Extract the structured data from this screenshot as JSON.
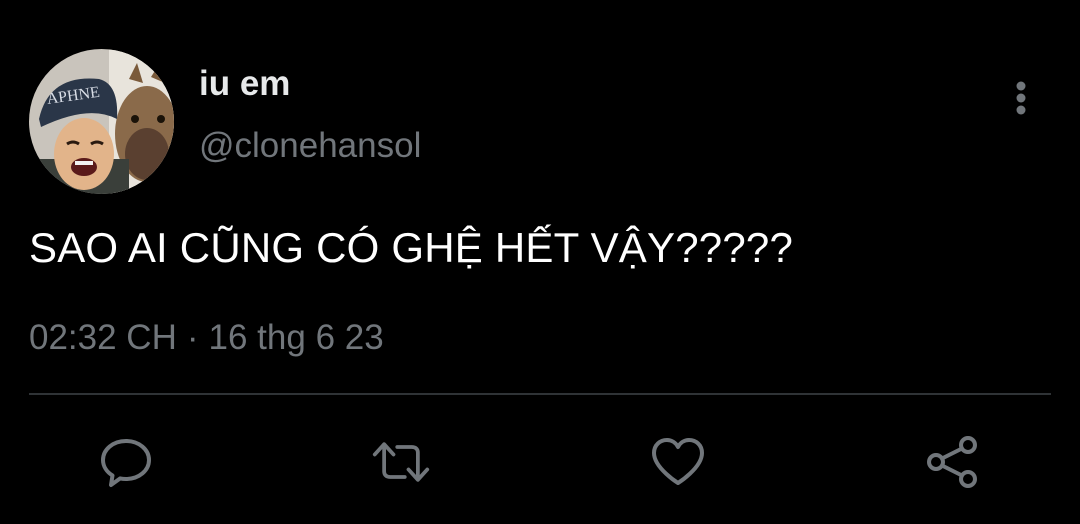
{
  "tweet": {
    "display_name": "iu em",
    "handle": "@clonehansol",
    "text": "SAO AI CŨNG CÓ GHỆ HẾT VẬY?????",
    "time": "02:32 CH",
    "separator": "·",
    "date": "16 thg 6 23"
  },
  "icons": {
    "more": "vertical-dots-icon",
    "reply": "speech-bubble-icon",
    "retweet": "retweet-arrows-icon",
    "like": "heart-icon",
    "share": "share-nodes-icon"
  },
  "colors": {
    "background": "#000000",
    "primary_text": "#ffffff",
    "secondary_text": "#71767b",
    "divider": "#2f3336"
  }
}
